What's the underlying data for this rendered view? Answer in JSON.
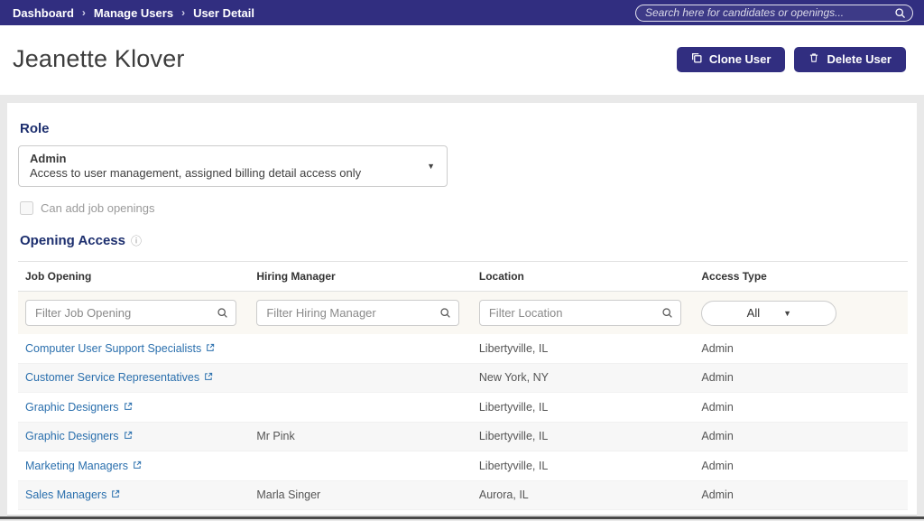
{
  "topbar": {
    "breadcrumb": [
      "Dashboard",
      "Manage Users",
      "User Detail"
    ],
    "separator": "›",
    "search_placeholder": "Search here for candidates or openings..."
  },
  "header": {
    "title": "Jeanette Klover",
    "clone_button": "Clone User",
    "delete_button": "Delete User"
  },
  "role": {
    "heading": "Role",
    "selected_name": "Admin",
    "selected_description": "Access to user management, assigned billing detail access only",
    "can_add_label": "Can add job openings",
    "can_add_checked": false
  },
  "opening_access": {
    "heading": "Opening Access",
    "info_icon": "ⓘ",
    "columns": [
      "Job Opening",
      "Hiring Manager",
      "Location",
      "Access Type"
    ],
    "filters": {
      "job_opening_placeholder": "Filter Job Opening",
      "hiring_manager_placeholder": "Filter Hiring Manager",
      "location_placeholder": "Filter Location",
      "access_type_value": "All"
    },
    "rows": [
      {
        "job_opening": "Computer User Support Specialists",
        "hiring_manager": "",
        "location": "Libertyville, IL",
        "access_type": "Admin"
      },
      {
        "job_opening": "Customer Service Representatives",
        "hiring_manager": "",
        "location": "New York, NY",
        "access_type": "Admin"
      },
      {
        "job_opening": "Graphic Designers",
        "hiring_manager": "",
        "location": "Libertyville, IL",
        "access_type": "Admin"
      },
      {
        "job_opening": "Graphic Designers",
        "hiring_manager": "Mr Pink",
        "location": "Libertyville, IL",
        "access_type": "Admin"
      },
      {
        "job_opening": "Marketing Managers",
        "hiring_manager": "",
        "location": "Libertyville, IL",
        "access_type": "Admin"
      },
      {
        "job_opening": "Sales Managers",
        "hiring_manager": "Marla Singer",
        "location": "Aurora, IL",
        "access_type": "Admin"
      }
    ]
  },
  "colors": {
    "brand": "#312e80",
    "link": "#2a6fad",
    "heading": "#1c2e6e"
  }
}
